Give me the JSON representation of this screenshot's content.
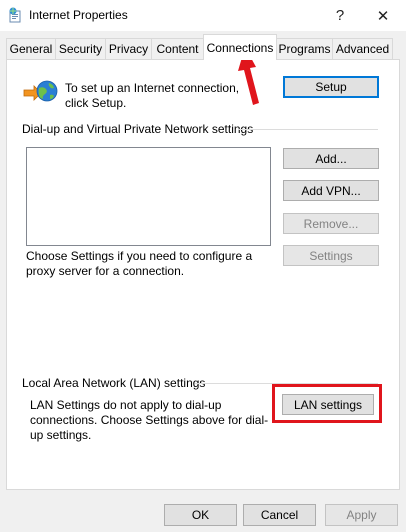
{
  "window": {
    "title": "Internet Properties",
    "help_glyph": "?",
    "close_glyph": "✕",
    "icon": "internet-options-icon"
  },
  "tabs": [
    {
      "label": "General"
    },
    {
      "label": "Security"
    },
    {
      "label": "Privacy"
    },
    {
      "label": "Content"
    },
    {
      "label": "Connections",
      "active": true
    },
    {
      "label": "Programs"
    },
    {
      "label": "Advanced"
    }
  ],
  "setup": {
    "text": "To set up an Internet connection, click Setup.",
    "button": "Setup",
    "icon": "globe-connection-icon"
  },
  "dialup": {
    "heading": "Dial-up and Virtual Private Network settings",
    "add_button": "Add...",
    "add_vpn_button": "Add VPN...",
    "remove_button": "Remove...",
    "settings_button": "Settings",
    "proxy_text": "Choose Settings if you need to configure a proxy server for a connection."
  },
  "lan": {
    "heading": "Local Area Network (LAN) settings",
    "text": "LAN Settings do not apply to dial-up connections. Choose Settings above for dial-up settings.",
    "button": "LAN settings"
  },
  "footer": {
    "ok": "OK",
    "cancel": "Cancel",
    "apply": "Apply"
  },
  "annotations": {
    "highlight_color": "#e0151c",
    "arrow_color": "#e0151c"
  }
}
